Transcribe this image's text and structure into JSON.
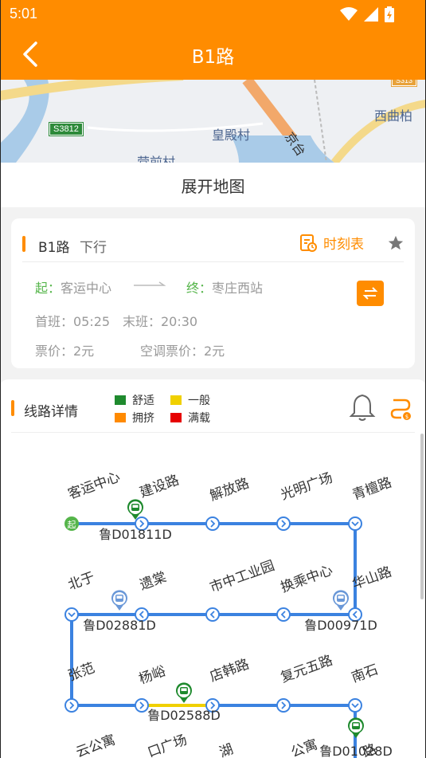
{
  "status_bar": {
    "time": "5:01"
  },
  "app_bar": {
    "title": "B1路"
  },
  "map": {
    "labels": [
      "皇殿村",
      "西曲柏",
      "营前村",
      "京台"
    ],
    "road_badges": [
      "S3812",
      "S313"
    ]
  },
  "expand_map_label": "展开地图",
  "route_info": {
    "route_name": "B1路",
    "direction": "下行",
    "timetable_label": "时刻表",
    "start_tag": "起：",
    "start_stop": "客运中心",
    "end_tag": "终：",
    "end_stop": "枣庄西站",
    "first_bus": "首班：05:25",
    "last_bus": "末班：20:30",
    "fare": "票价：2元",
    "ac_fare": "空调票价：2元"
  },
  "line_detail": {
    "title": "线路详情",
    "legend": [
      {
        "label": "舒适",
        "color": "#1f8a2e"
      },
      {
        "label": "一般",
        "color": "#f0d000"
      },
      {
        "label": "拥挤",
        "color": "#ff8a00"
      },
      {
        "label": "满载",
        "color": "#e60000"
      }
    ],
    "start_marker": "起",
    "stops_row1": [
      "客运中心",
      "建设路",
      "解放路",
      "光明广场",
      "青檀路"
    ],
    "stops_row2": [
      "华山路",
      "换乘中心",
      "市中工业园",
      "遗棠",
      "北于"
    ],
    "stops_row3": [
      "张范",
      "杨峪",
      "店韩路",
      "复元五路",
      "南石"
    ],
    "stops_row4_partial": [
      "云公寓",
      "口广场",
      "湖",
      "公寓",
      "路"
    ],
    "buses": [
      {
        "id": "鲁D01811D",
        "status": "舒适"
      },
      {
        "id": "鲁D02881D",
        "status": "未知"
      },
      {
        "id": "鲁D00971D",
        "status": "未知"
      },
      {
        "id": "鲁D02588D",
        "status": "舒适"
      },
      {
        "id": "鲁D01028D",
        "status": "舒适"
      }
    ],
    "line_color": "#3b82e0",
    "crowded_segment_color": "#f0d000"
  }
}
